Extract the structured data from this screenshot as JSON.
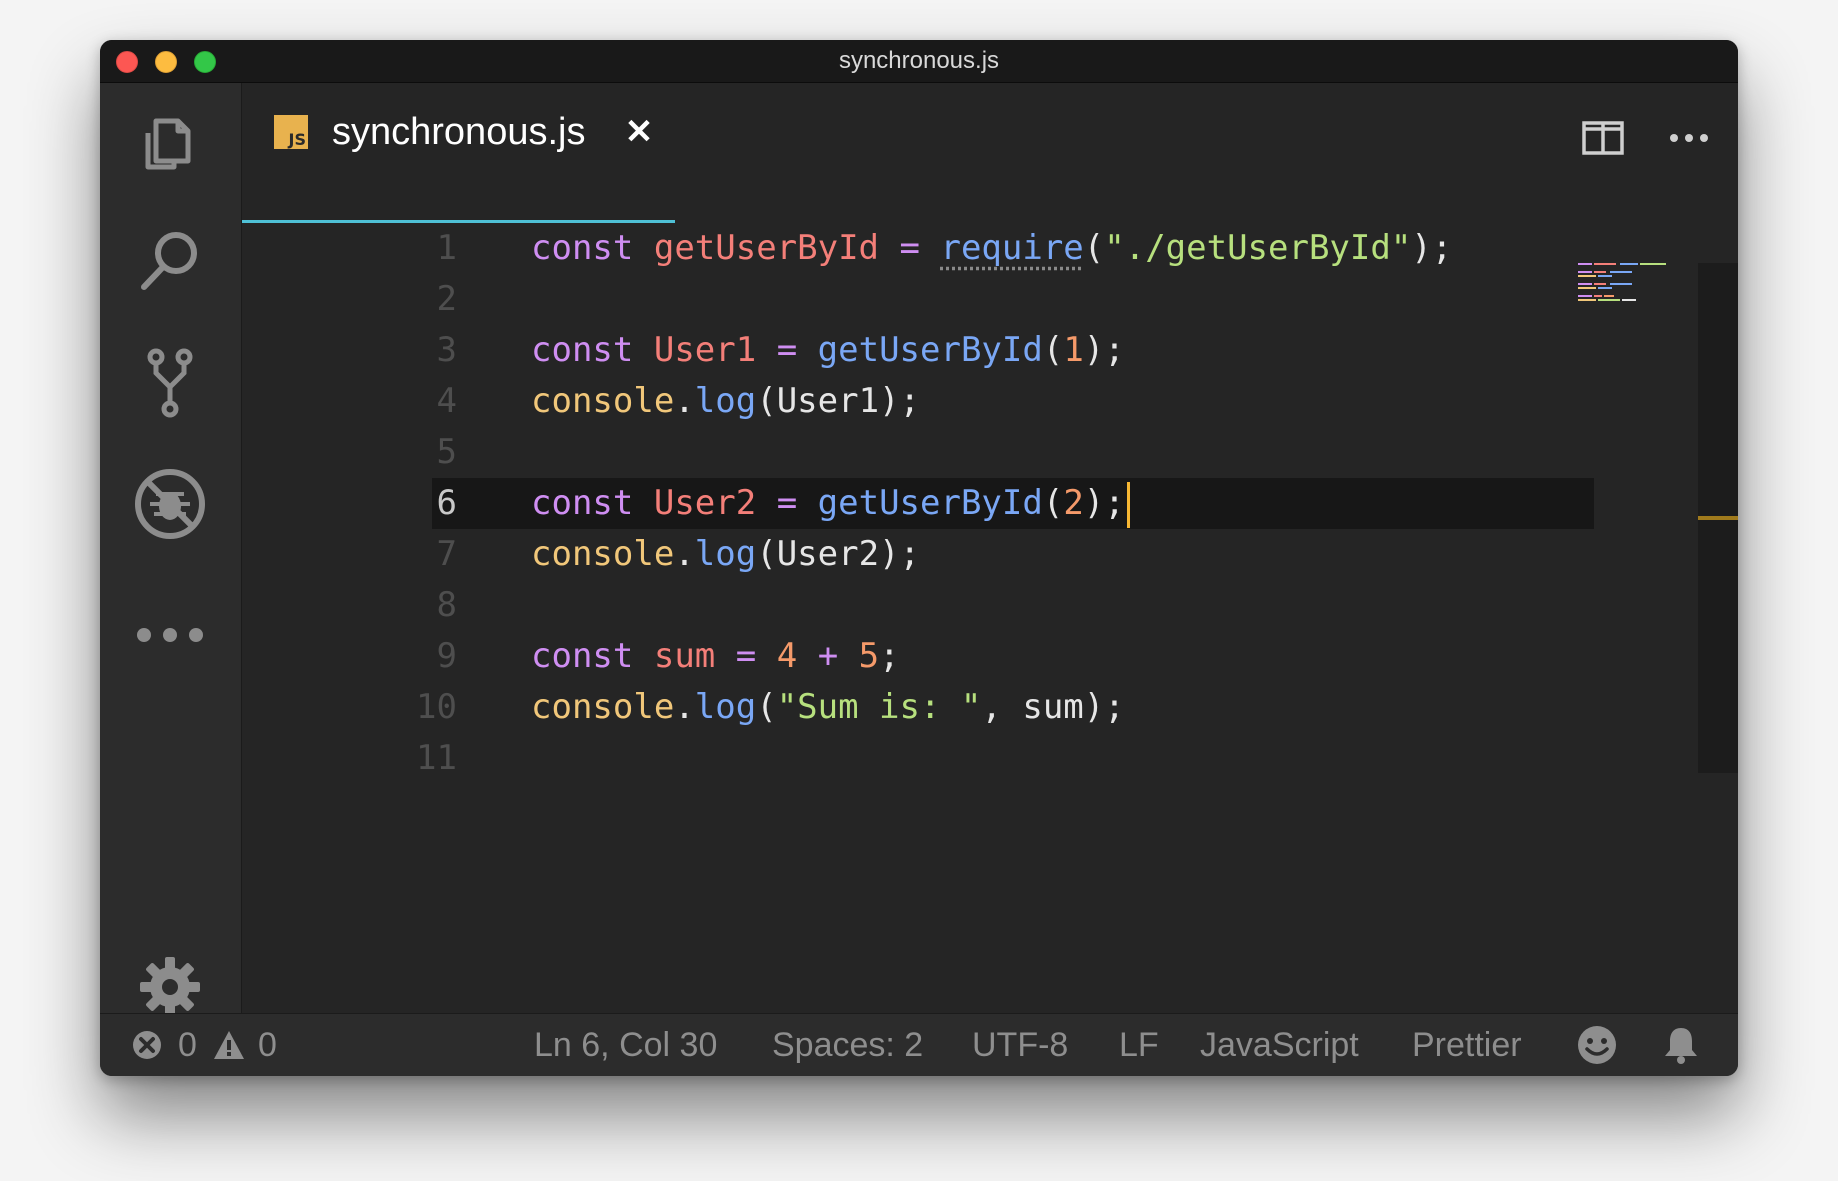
{
  "window": {
    "title": "synchronous.js"
  },
  "tab": {
    "icon_text": "JS",
    "title": "synchronous.js",
    "close_glyph": "✕"
  },
  "editor": {
    "current_line": 6,
    "lines": [
      {
        "n": "1"
      },
      {
        "n": "2"
      },
      {
        "n": "3"
      },
      {
        "n": "4"
      },
      {
        "n": "5"
      },
      {
        "n": "6"
      },
      {
        "n": "7"
      },
      {
        "n": "8"
      },
      {
        "n": "9"
      },
      {
        "n": "10"
      },
      {
        "n": "11"
      }
    ],
    "code": {
      "l1": {
        "kw": "const",
        "var": "getUserById",
        "eq": "=",
        "fn": "require",
        "open": "(",
        "str": "\"./getUserById\"",
        "close": ");"
      },
      "l3": {
        "kw": "const",
        "var": "User1",
        "eq": "=",
        "fn": "getUserById",
        "open": "(",
        "num": "1",
        "close": ");"
      },
      "l4": {
        "obj": "console",
        "dot": ".",
        "fn": "log",
        "open": "(",
        "arg": "User1",
        "close": ");"
      },
      "l6": {
        "kw": "const",
        "var": "User2",
        "eq": "=",
        "fn": "getUserById",
        "open": "(",
        "num": "2",
        "close": ");"
      },
      "l7": {
        "obj": "console",
        "dot": ".",
        "fn": "log",
        "open": "(",
        "arg": "User2",
        "close": ");"
      },
      "l9": {
        "kw": "const",
        "var": "sum",
        "eq": "=",
        "a": "4",
        "plus": "+",
        "b": "5",
        "semi": ";"
      },
      "l10": {
        "obj": "console",
        "dot": ".",
        "fn": "log",
        "open": "(",
        "str": "\"Sum is: \"",
        "comma": ",",
        "arg": "sum",
        "close": ");"
      }
    }
  },
  "status": {
    "errors": "0",
    "warnings": "0",
    "position": "Ln 6, Col 30",
    "spaces": "Spaces: 2",
    "encoding": "UTF-8",
    "eol": "LF",
    "language": "JavaScript",
    "formatter": "Prettier"
  },
  "colors": {
    "keyword": "#cf8ef2",
    "variable": "#f47f79",
    "function": "#7aa7f5",
    "string": "#b7e07e",
    "number": "#f59a6a",
    "object": "#f1c77a",
    "tab_underline": "#4fc1d6",
    "cursor": "#f7b733"
  },
  "icons": {
    "activity": [
      "explorer-icon",
      "search-icon",
      "source-control-icon",
      "debug-icon",
      "more-icon",
      "settings-icon"
    ],
    "status": [
      "error-icon",
      "warning-icon",
      "feedback-smiley-icon",
      "notification-bell-icon"
    ]
  }
}
